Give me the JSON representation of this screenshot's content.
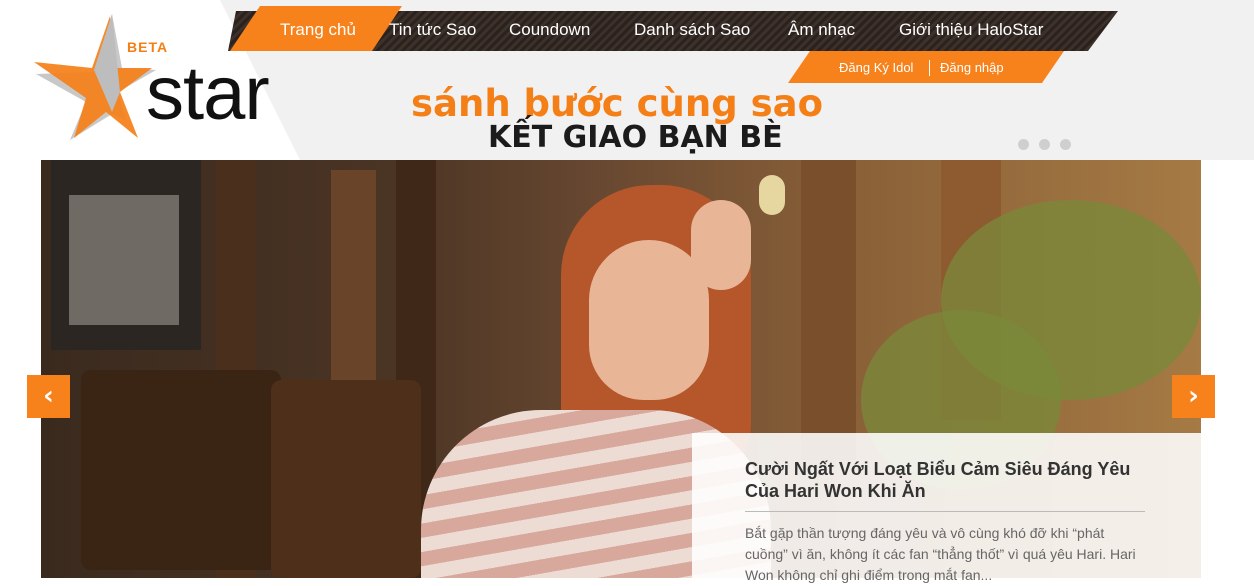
{
  "logo": {
    "beta": "BETA",
    "text": "star",
    "accent": "#f57f17"
  },
  "nav": {
    "items": [
      {
        "label": "Trang chủ",
        "active": true
      },
      {
        "label": "Tin tức Sao"
      },
      {
        "label": "Coundown"
      },
      {
        "label": "Danh sách Sao"
      },
      {
        "label": "Âm nhạc"
      },
      {
        "label": "Giới thiệu HaloStar"
      }
    ],
    "sub": [
      "Đăng Ký Idol",
      "Đăng nhập"
    ]
  },
  "slogan": {
    "line1": "sánh bước cùng sao",
    "line2": "KẾT GIAO BẠN BÈ"
  },
  "slider": {
    "dots": 3,
    "active_dot": 1,
    "prev_icon": "chevron-left-icon",
    "next_icon": "chevron-right-icon",
    "caption": {
      "title": "Cười Ngất Với Loạt Biểu Cảm Siêu Đáng Yêu Của Hari Won Khi Ăn",
      "description": "Bắt gặp thần tượng đáng yêu và vô cùng khó đỡ khi “phát cuồng” vì ăn, không ít các fan “thẳng thốt” vì quá yêu Hari. Hari Won không chỉ ghi điểm trong mắt fan..."
    }
  }
}
